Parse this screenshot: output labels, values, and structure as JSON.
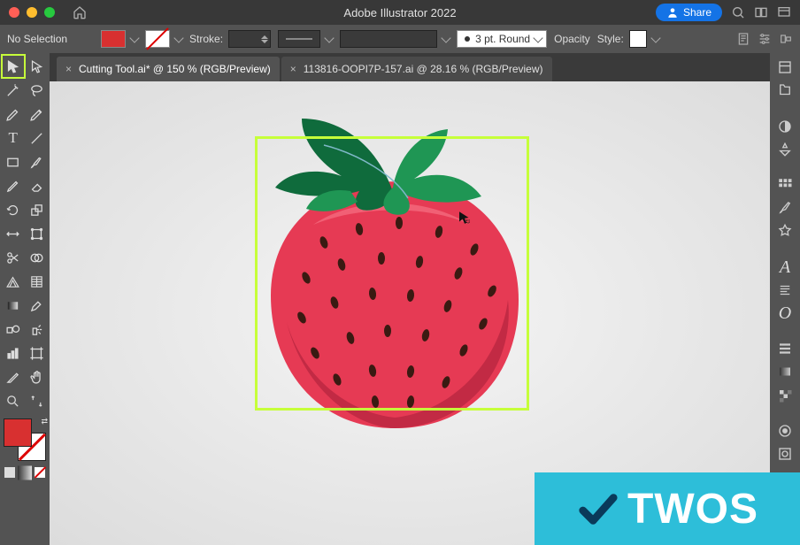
{
  "titlebar": {
    "app_title": "Adobe Illustrator 2022"
  },
  "share": {
    "label": "Share"
  },
  "controlbar": {
    "selection": "No Selection",
    "stroke_label": "Stroke:",
    "brush_label": "3 pt. Round",
    "opacity_label": "Opacity",
    "style_label": "Style:"
  },
  "tabs": [
    {
      "label": "Cutting Tool.ai* @ 150 % (RGB/Preview)",
      "active": true
    },
    {
      "label": "113816-OOPI7P-157.ai @ 28.16 % (RGB/Preview)",
      "active": false
    }
  ],
  "badge": {
    "text": "TWOS"
  }
}
